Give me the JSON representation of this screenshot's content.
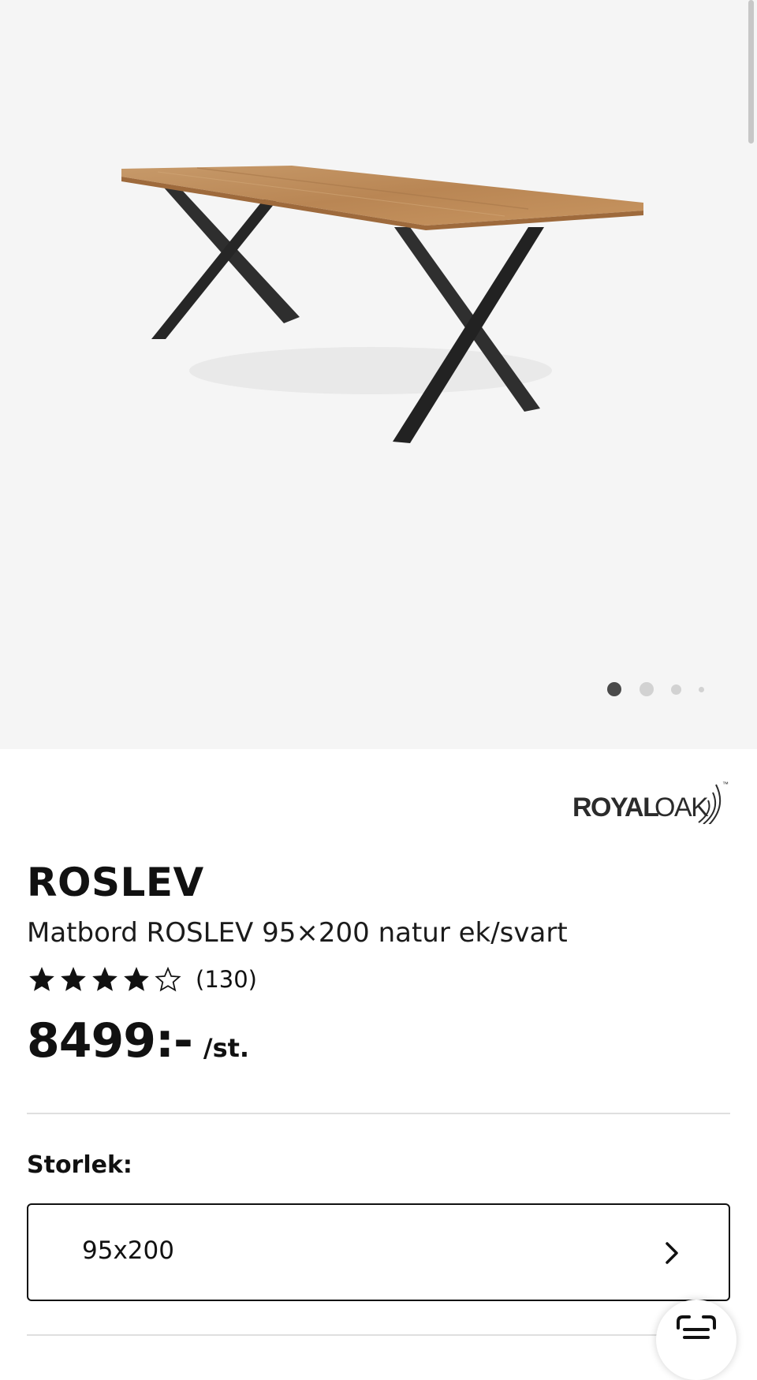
{
  "gallery": {
    "image_alt": "Matbord ROSLEV",
    "dot_count": 4,
    "active_index": 0
  },
  "brand": {
    "name_bold": "ROYAL",
    "name_light": "OAK",
    "trademark": "™"
  },
  "product": {
    "name": "ROSLEV",
    "description": "Matbord ROSLEV 95×200 natur ek/svart",
    "rating": 4,
    "rating_max": 5,
    "review_count": "(130)",
    "price": "8499:-",
    "price_unit": "/st."
  },
  "size": {
    "label": "Storlek:",
    "selected": "95x200"
  },
  "icons": {
    "next": "chevron-right-icon",
    "scan": "scan-icon",
    "star_full": "star-filled-icon",
    "star_empty": "star-outline-icon"
  },
  "colors": {
    "hero_background": "#f5f5f5",
    "text": "#111111",
    "divider": "#dfdfdf"
  }
}
